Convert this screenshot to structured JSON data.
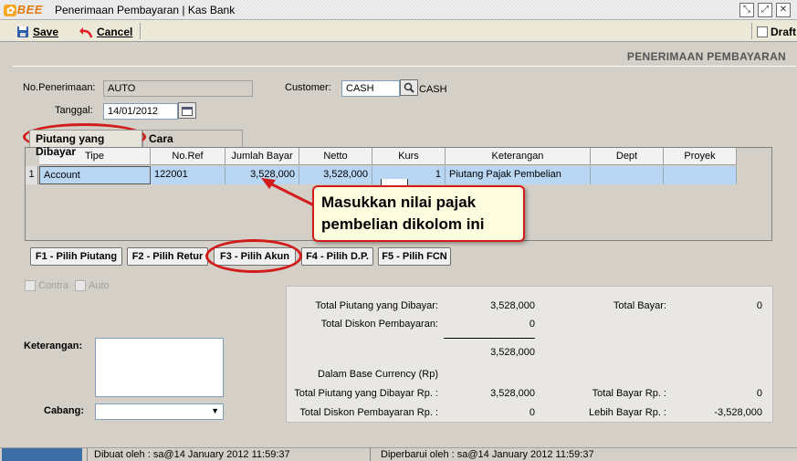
{
  "window": {
    "title": "Penerimaan Pembayaran | Kas Bank",
    "logo": "BEE"
  },
  "toolbar": {
    "save_label": "Save",
    "cancel_label": "Cancel",
    "draft_label": "Draft"
  },
  "heading": "PENERIMAAN PEMBAYARAN",
  "form": {
    "no_penerimaan_label": "No.Penerimaan:",
    "no_penerimaan_value": "AUTO",
    "customer_label": "Customer:",
    "customer_value": "CASH",
    "customer_name": "CASH",
    "tanggal_label": "Tanggal:",
    "tanggal_value": "14/01/2012"
  },
  "tabs": [
    {
      "label": "Piutang yang Dibayar"
    },
    {
      "label": "Cara Pembayaran"
    }
  ],
  "grid": {
    "columns": [
      "Tipe",
      "No.Ref",
      "Jumlah Bayar",
      "Netto",
      "Kurs",
      "Keterangan",
      "Dept",
      "Proyek"
    ],
    "rows": [
      {
        "num": "1",
        "tipe": "Account",
        "noref": "122001",
        "jumlah": "3,528,000",
        "netto": "3,528,000",
        "kurs": "1",
        "keterangan": "Piutang Pajak Pembelian",
        "dept": "",
        "proyek": ""
      }
    ]
  },
  "callout": {
    "line1": "Masukkan nilai pajak",
    "line2": "pembelian dikolom ini"
  },
  "fbuttons": [
    {
      "label": "F1 - Pilih Piutang"
    },
    {
      "label": "F2 - Pilih Retur"
    },
    {
      "label": "F3 - Pilih Akun"
    },
    {
      "label": "F4 - Pilih D.P."
    },
    {
      "label": "F5 - Pilih FCN"
    }
  ],
  "options": {
    "contra_label": "Contra",
    "auto_label": "Auto"
  },
  "left": {
    "keterangan_label": "Keterangan:",
    "cabang_label": "Cabang:"
  },
  "summary": {
    "total_piutang_label": "Total Piutang yang Dibayar:",
    "total_piutang_value": "3,528,000",
    "total_diskon_label": "Total Diskon Pembayaran:",
    "total_diskon_value": "0",
    "subtotal_value": "3,528,000",
    "base_currency_label": "Dalam Base Currency (Rp)",
    "total_piutang_rp_label": "Total Piutang yang Dibayar Rp. :",
    "total_piutang_rp_value": "3,528,000",
    "total_diskon_rp_label": "Total Diskon Pembayaran Rp. :",
    "total_diskon_rp_value": "0",
    "total_bayar_label": "Total Bayar:",
    "total_bayar_value": "0",
    "total_bayar_rp_label": "Total Bayar Rp. :",
    "total_bayar_rp_value": "0",
    "lebih_bayar_label": "Lebih Bayar Rp. :",
    "lebih_bayar_value": "-3,528,000"
  },
  "status": {
    "dibuat": "Dibuat oleh : sa@14 January 2012  11:59:37",
    "diperbarui": "Diperbarui oleh : sa@14 January 2012  11:59:37"
  },
  "colors": {
    "accent_red": "#d21b1b",
    "row_selected": "#b9d6f3"
  }
}
